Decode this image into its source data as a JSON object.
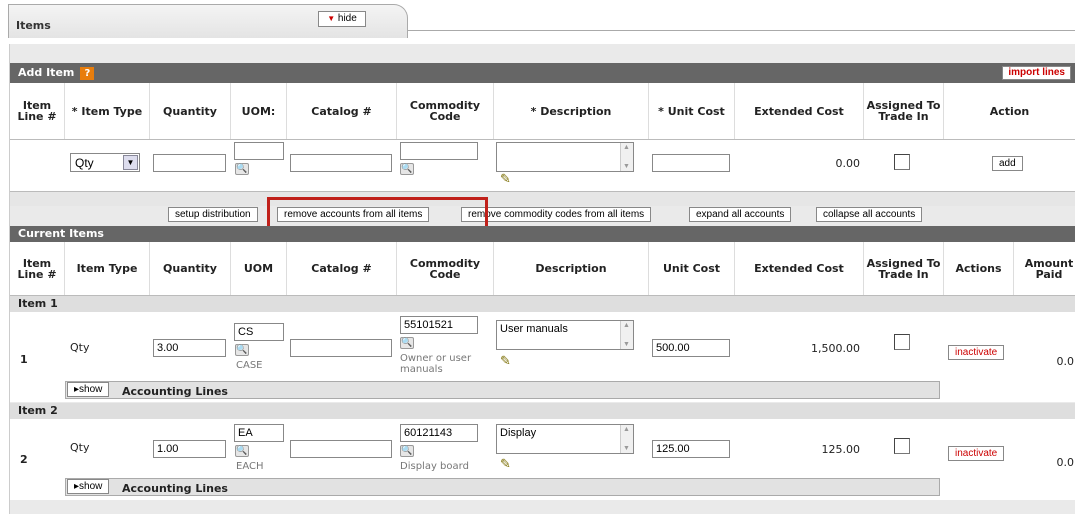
{
  "tab": {
    "title": "Items",
    "hide_label": "hide"
  },
  "add_item": {
    "title": "Add Item",
    "import_label": "import lines",
    "headers": [
      "Item Line #",
      "* Item Type",
      "Quantity",
      "UOM:",
      "Catalog #",
      "Commodity Code",
      "* Description",
      "* Unit Cost",
      "Extended Cost",
      "Assigned To Trade In",
      "Action"
    ],
    "item_type_selected": "Qty",
    "extended_cost": "0.00",
    "add_label": "add"
  },
  "toolbar": {
    "setup_distribution": "setup distribution",
    "remove_accounts": "remove accounts from all items",
    "remove_commodity": "remove commodity codes from all items",
    "expand_all": "expand all accounts",
    "collapse_all": "collapse all accounts"
  },
  "current_items": {
    "title": "Current Items",
    "headers": [
      "Item Line #",
      "Item Type",
      "Quantity",
      "UOM",
      "Catalog #",
      "Commodity Code",
      "Description",
      "Unit Cost",
      "Extended Cost",
      "Assigned To Trade In",
      "Actions",
      "Amount Paid"
    ],
    "items": [
      {
        "label": "Item 1",
        "line": "1",
        "type": "Qty",
        "quantity": "3.00",
        "uom": "CS",
        "uom_desc": "CASE",
        "catalog": "",
        "commodity": "55101521",
        "commodity_desc": "Owner or user manuals",
        "description": "User manuals",
        "unit_cost": "500.00",
        "extended_cost": "1,500.00",
        "action": "inactivate",
        "amount_paid": "0.0"
      },
      {
        "label": "Item 2",
        "line": "2",
        "type": "Qty",
        "quantity": "1.00",
        "uom": "EA",
        "uom_desc": "EACH",
        "catalog": "",
        "commodity": "60121143",
        "commodity_desc": "Display board",
        "description": "Display",
        "unit_cost": "125.00",
        "extended_cost": "125.00",
        "action": "inactivate",
        "amount_paid": "0.0"
      }
    ],
    "show_label": "show",
    "accounting_lines": "Accounting Lines"
  },
  "colors": {
    "header_bar": "#666666",
    "highlight_box": "#c0201a",
    "help_icon": "#e87d0c"
  },
  "icons": {
    "help": "help-icon",
    "lookup": "magnifier-icon",
    "pencil": "pencil-icon"
  }
}
